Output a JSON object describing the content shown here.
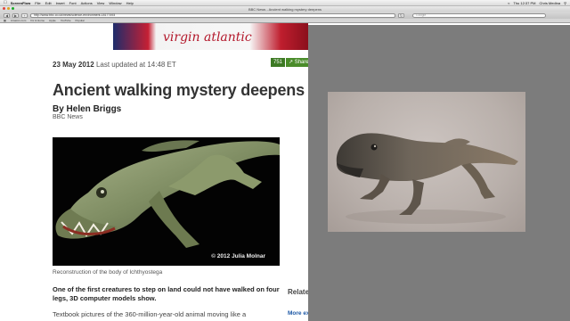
{
  "menubar": {
    "app_name": "ScreenFlow",
    "items": [
      "File",
      "Edit",
      "Insert",
      "Font",
      "Actions",
      "View",
      "Window",
      "Help"
    ],
    "clock": "Thu 12:37 PM",
    "user": "Chris Medina"
  },
  "browser": {
    "window_title": "BBC News - Ancient walking mystery deepens",
    "url": "http://www.bbc.co.uk/news/science-environment-18177493",
    "search_placeholder": "Google",
    "bookmarks": [
      "Amazon.com",
      "Fix & Home",
      "Apple",
      "YouTube",
      "Popular"
    ]
  },
  "page": {
    "ad_text": "virgin atlantic",
    "date": "23 May 2012",
    "updated": "Last updated at 14:48 ET",
    "share_count": "751",
    "share_label": "Share",
    "headline": "Ancient walking mystery deepens",
    "byline": "By Helen Briggs",
    "source": "BBC News",
    "photo_credit": "© 2012 Julia Molnar",
    "caption": "Reconstruction of the body of Ichthyostega",
    "lede": "One of the first creatures to step on land could not have walked on four legs, 3D computer models show.",
    "body_text": "Textbook pictures of the 360-million-year-old animal moving like a",
    "related_heading": "Relate",
    "related_link": "More extra infrmd"
  },
  "colors": {
    "share_green": "#4a8c2a",
    "link_blue": "#1b57a5",
    "overlay_grey": "#7c7c7c"
  }
}
